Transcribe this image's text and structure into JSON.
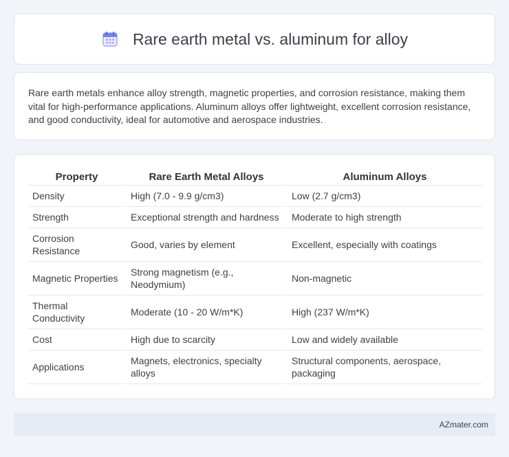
{
  "header": {
    "title": "Rare earth metal vs. aluminum for alloy",
    "icon": "calendar-icon"
  },
  "summary": {
    "text": "Rare earth metals enhance alloy strength, magnetic properties, and corrosion resistance, making them vital for high-performance applications. Aluminum alloys offer lightweight, excellent corrosion resistance, and good conductivity, ideal for automotive and aerospace industries."
  },
  "table": {
    "headers": [
      "Property",
      "Rare Earth Metal Alloys",
      "Aluminum Alloys"
    ],
    "rows": [
      [
        "Density",
        "High (7.0 - 9.9 g/cm3)",
        "Low (2.7 g/cm3)"
      ],
      [
        "Strength",
        "Exceptional strength and hardness",
        "Moderate to high strength"
      ],
      [
        "Corrosion Resistance",
        "Good, varies by element",
        "Excellent, especially with coatings"
      ],
      [
        "Magnetic Properties",
        "Strong magnetism (e.g., Neodymium)",
        "Non-magnetic"
      ],
      [
        "Thermal Conductivity",
        "Moderate (10 - 20 W/m*K)",
        "High (237 W/m*K)"
      ],
      [
        "Cost",
        "High due to scarcity",
        "Low and widely available"
      ],
      [
        "Applications",
        "Magnets, electronics, specialty alloys",
        "Structural components, aerospace, packaging"
      ]
    ]
  },
  "footer": {
    "brand": "AZmater.com"
  },
  "colors": {
    "background": "#f1f4f9",
    "card": "#ffffff",
    "footer_bar": "#e6ecf6"
  }
}
